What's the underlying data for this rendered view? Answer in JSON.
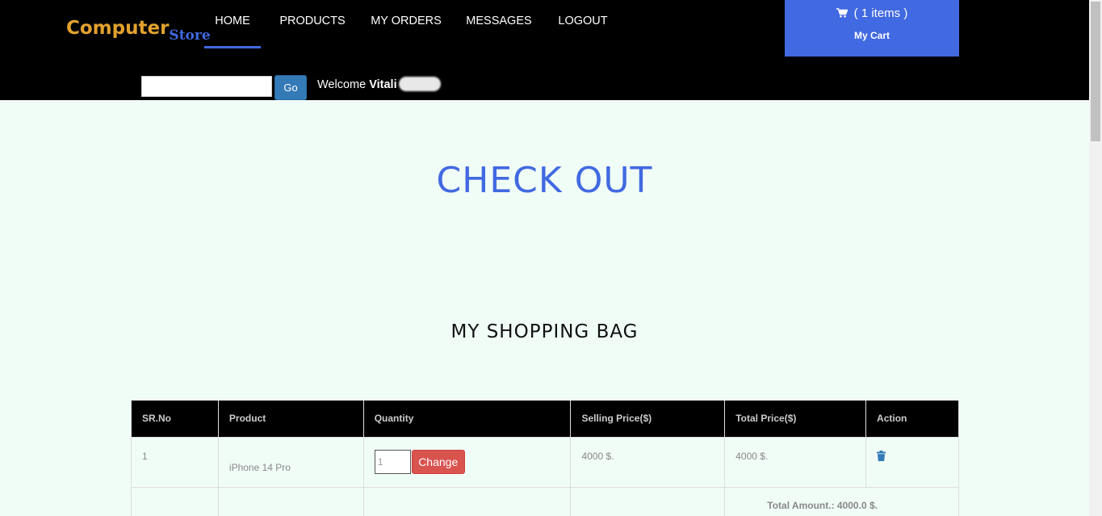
{
  "header": {
    "logo_main": "Computer",
    "logo_sub": "Store",
    "nav": [
      {
        "label": "HOME",
        "active": true
      },
      {
        "label": "PRODUCTS",
        "active": false
      },
      {
        "label": "MY ORDERS",
        "active": false
      },
      {
        "label": "MESSAGES",
        "active": false
      },
      {
        "label": "LOGOUT",
        "active": false
      }
    ],
    "cart_count": "( 1 items )",
    "cart_label": "My Cart",
    "search_value": "",
    "go_label": "Go",
    "welcome_prefix": "Welcome",
    "user_name": "Vitali"
  },
  "page": {
    "title": "CHECK OUT",
    "subtitle": "MY SHOPPING BAG"
  },
  "table": {
    "headers": [
      "SR.No",
      "Product",
      "Quantity",
      "Selling Price($)",
      "Total Price($)",
      "Action"
    ],
    "rows": [
      {
        "sr": "1",
        "product": "iPhone 14 Pro",
        "quantity": "1",
        "change_label": "Change",
        "selling_price": "4000 $.",
        "total_price": "4000 $."
      }
    ],
    "total_amount": "Total Amount.: 4000.0 $."
  },
  "colors": {
    "accent": "#4169e1",
    "logo": "#e2a22e",
    "danger": "#d9534f",
    "background": "#f0fdf7"
  }
}
